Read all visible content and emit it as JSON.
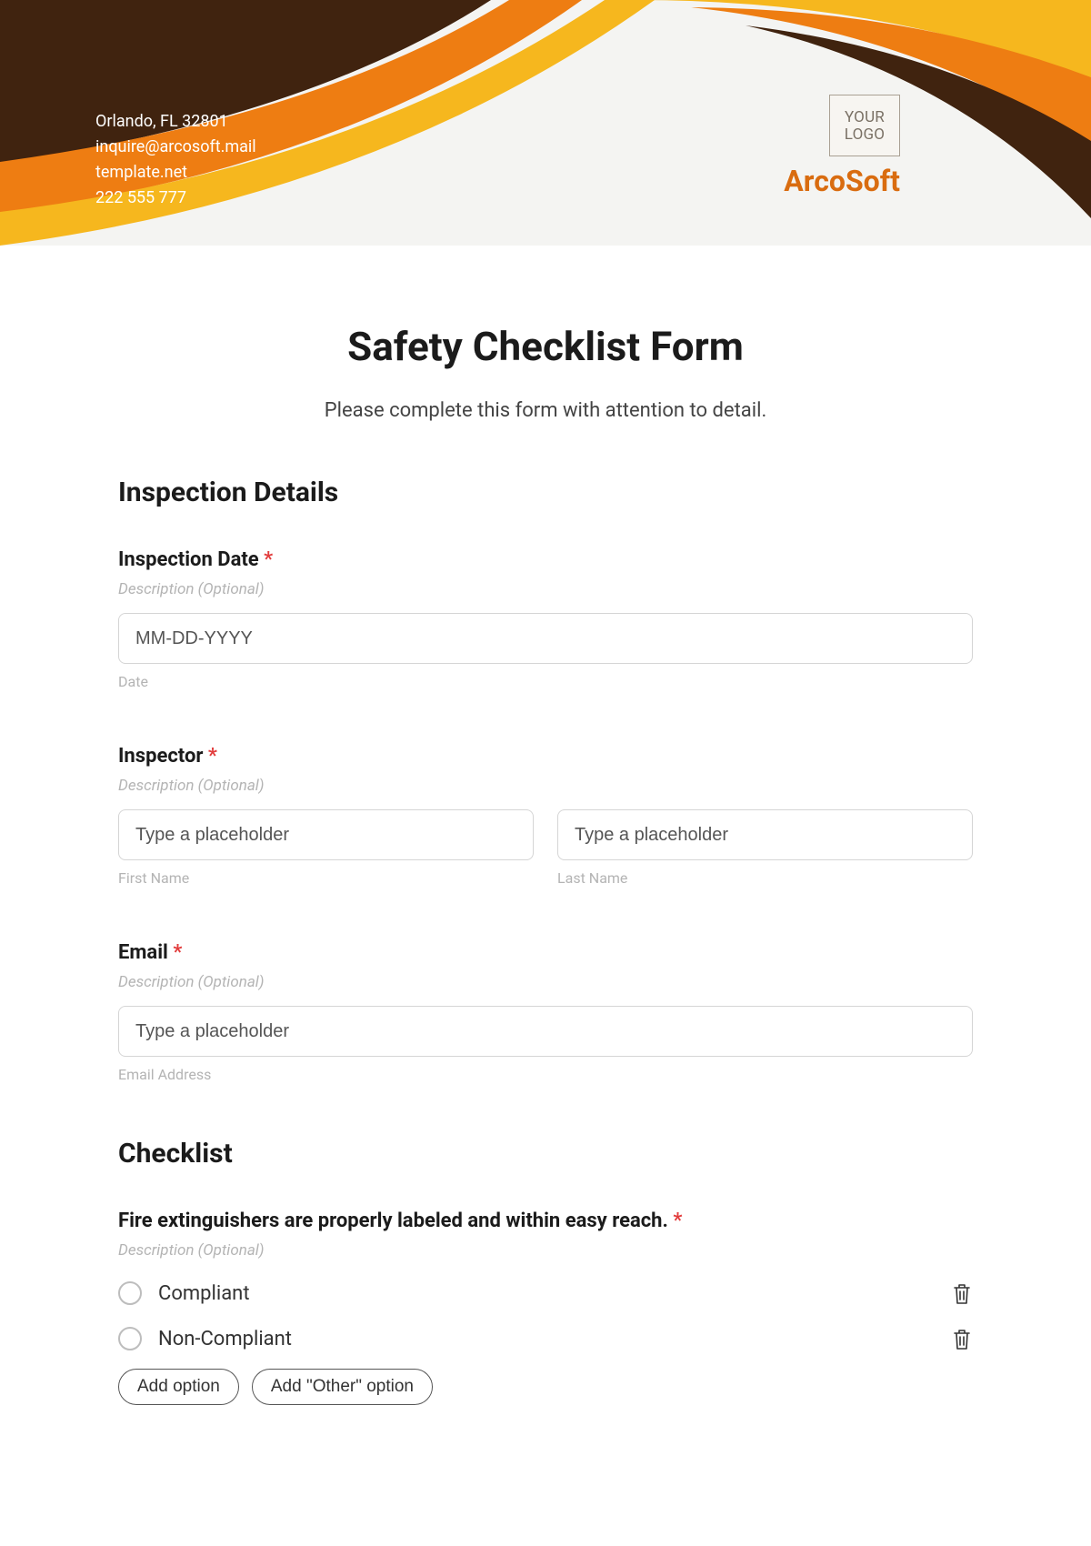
{
  "header": {
    "address": "Orlando, FL 32801",
    "email": "inquire@arcosoft.mail",
    "site": "template.net",
    "phone": "222 555 777",
    "logo_line1": "YOUR",
    "logo_line2": "LOGO",
    "brand": "ArcoSoft"
  },
  "form": {
    "title": "Safety Checklist Form",
    "subtitle": "Please complete this form with attention to detail.",
    "required_marker": "*"
  },
  "sections": {
    "inspection": {
      "heading": "Inspection Details",
      "date": {
        "label": "Inspection Date",
        "desc": "Description (Optional)",
        "placeholder": "MM-DD-YYYY",
        "sublabel": "Date"
      },
      "inspector": {
        "label": "Inspector",
        "desc": "Description (Optional)",
        "first_placeholder": "Type a placeholder",
        "last_placeholder": "Type a placeholder",
        "first_sublabel": "First Name",
        "last_sublabel": "Last Name"
      },
      "email": {
        "label": "Email",
        "desc": "Description (Optional)",
        "placeholder": "Type a placeholder",
        "sublabel": "Email Address"
      }
    },
    "checklist": {
      "heading": "Checklist",
      "item1": {
        "label": "Fire extinguishers are properly labeled and within easy reach.",
        "desc": "Description (Optional)",
        "opt1": "Compliant",
        "opt2": "Non-Compliant"
      },
      "add_option": "Add option",
      "add_other": "Add \"Other\" option"
    }
  }
}
